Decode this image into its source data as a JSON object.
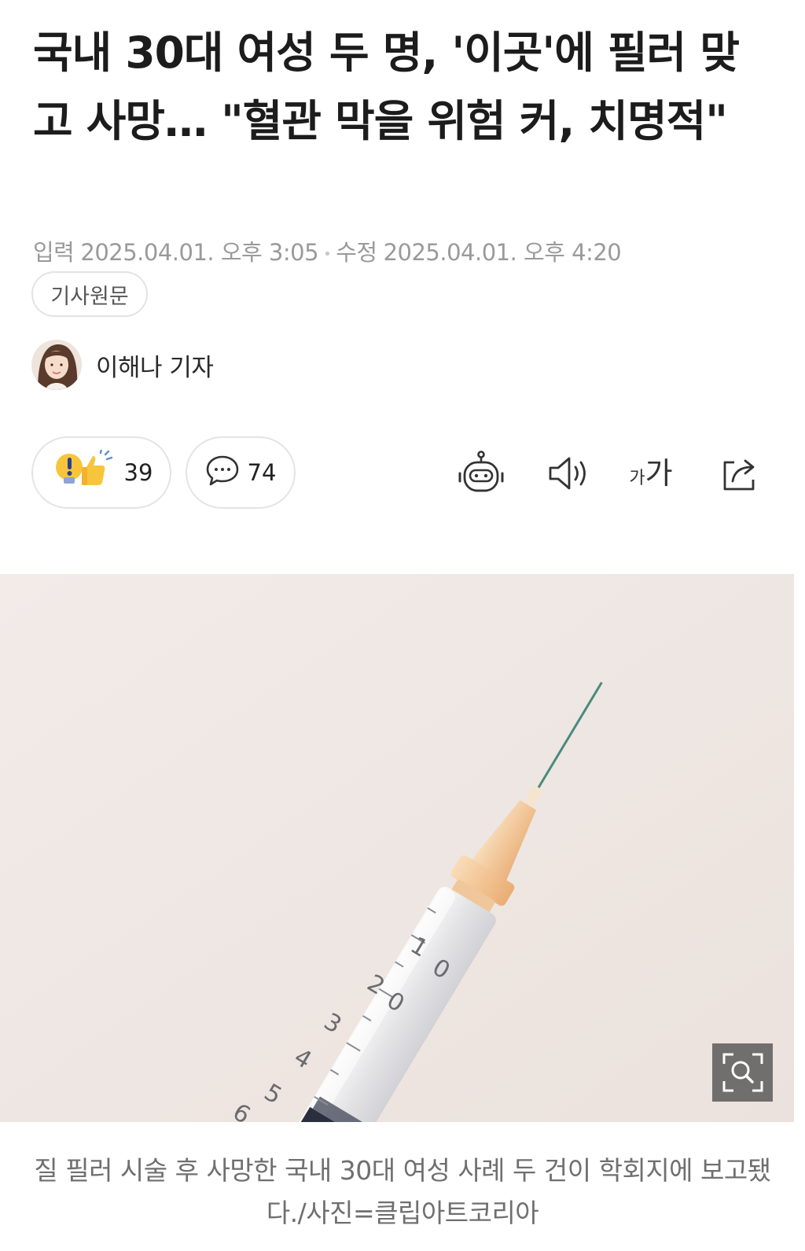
{
  "article": {
    "headline": "국내 30대 여성 두 명, '이곳'에 필러 맞고 사망… \"혈관 막을 위험 커, 치명적\"",
    "input_label": "입력",
    "input_time": "2025.04.01. 오후 3:05",
    "edit_label": "수정",
    "edit_time": "2025.04.01. 오후 4:20",
    "original_button": "기사원문",
    "author": "이해나 기자"
  },
  "actions": {
    "reaction_count": "39",
    "comment_count": "74",
    "font_size_icon_text_small": "가",
    "font_size_icon_text_large": "가",
    "icons": [
      "reaction-icon",
      "comment-icon",
      "robot-summary-icon",
      "speaker-icon",
      "font-size-icon",
      "share-icon"
    ]
  },
  "image": {
    "caption": "질 필러 시술 후 사망한 국내 30대 여성 사례 두 건이 학회지에 보고됐다./사진=클립아트코리아",
    "syringe_marks": [
      "1",
      "0",
      "2",
      "0",
      "3",
      "4",
      "5",
      "6"
    ]
  },
  "colors": {
    "headline": "#1c1c1c",
    "meta": "#9a9a9a",
    "photo_bg": "#efe7e3",
    "hub_orange": "#f4c89a"
  }
}
